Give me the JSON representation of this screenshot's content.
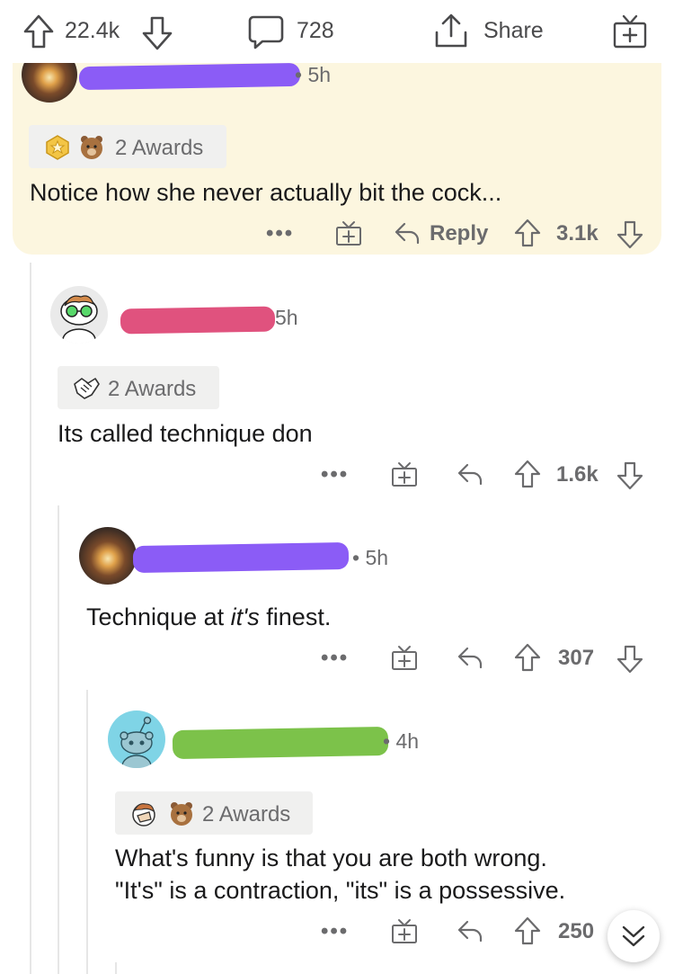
{
  "topbar": {
    "upvotes": "22.4k",
    "comments": "728",
    "share_label": "Share"
  },
  "comments": [
    {
      "id": "c1",
      "time": "• 5h",
      "awards_label": "2 Awards",
      "body": "Notice how she never actually bit the cock...",
      "reply_label": "Reply",
      "score": "3.1k",
      "more": "•••"
    },
    {
      "id": "c2",
      "time": "5h",
      "awards_label": "2 Awards",
      "body": "Its called technique don",
      "score": "1.6k",
      "more": "•••"
    },
    {
      "id": "c3",
      "time": "• 5h",
      "body_pre": "Technique at ",
      "body_em": "it's",
      "body_post": " finest.",
      "score": "307",
      "more": "•••"
    },
    {
      "id": "c4",
      "time": "• 4h",
      "awards_label": "2 Awards",
      "body_line1": "What's funny is that you are both wrong.",
      "body_line2": "\"It's\" is a contraction, \"its\" is a possessive.",
      "score": "250",
      "more": "•••"
    }
  ],
  "colors": {
    "highlight_bg": "#fcf6df",
    "censor_purple": "#8b5cf6",
    "censor_pink": "#e0527e",
    "censor_green": "#7cc24a",
    "text": "#1a1a1b",
    "muted": "#6b6b6d"
  },
  "icons": [
    "upvote-icon",
    "downvote-icon",
    "comment-icon",
    "share-icon",
    "gift-icon",
    "reply-icon",
    "award-icon",
    "collapse-chevron-icon"
  ]
}
